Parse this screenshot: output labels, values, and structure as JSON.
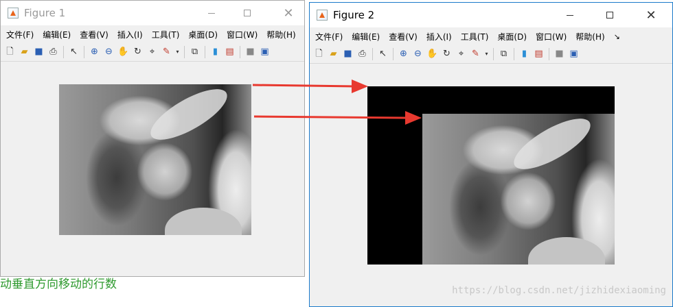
{
  "figure1": {
    "title": "Figure 1",
    "menu": [
      "文件(F)",
      "编辑(E)",
      "查看(V)",
      "插入(I)",
      "工具(T)",
      "桌面(D)",
      "窗口(W)",
      "帮助(H)"
    ],
    "menu_more": "↘"
  },
  "figure2": {
    "title": "Figure 2",
    "menu": [
      "文件(F)",
      "编辑(E)",
      "查看(V)",
      "插入(I)",
      "工具(T)",
      "桌面(D)",
      "窗口(W)",
      "帮助(H)"
    ],
    "menu_more": "↘"
  },
  "window_controls": {
    "minimize": "─",
    "maximize": "☐",
    "close": "✕"
  },
  "toolbar_icons": [
    "new-figure-icon",
    "open-file-icon",
    "save-icon",
    "print-icon",
    "select-arrow-icon",
    "zoom-in-icon",
    "zoom-out-icon",
    "pan-hand-icon",
    "rotate-3d-icon",
    "data-cursor-icon",
    "brush-icon",
    "link-plot-icon",
    "colorbar-icon",
    "legend-icon",
    "hide-plot-tools-icon",
    "show-plot-tools-icon"
  ],
  "background_text": {
    "code_comment": "动垂直方向移动的行数",
    "watermark": "https://blog.csdn.net/jizhidexiaoming"
  },
  "colors": {
    "arrow": "#e8392f",
    "active_border": "#1979ca",
    "code_comment": "#2e9a2e",
    "window_bg": "#f0f0f0"
  }
}
